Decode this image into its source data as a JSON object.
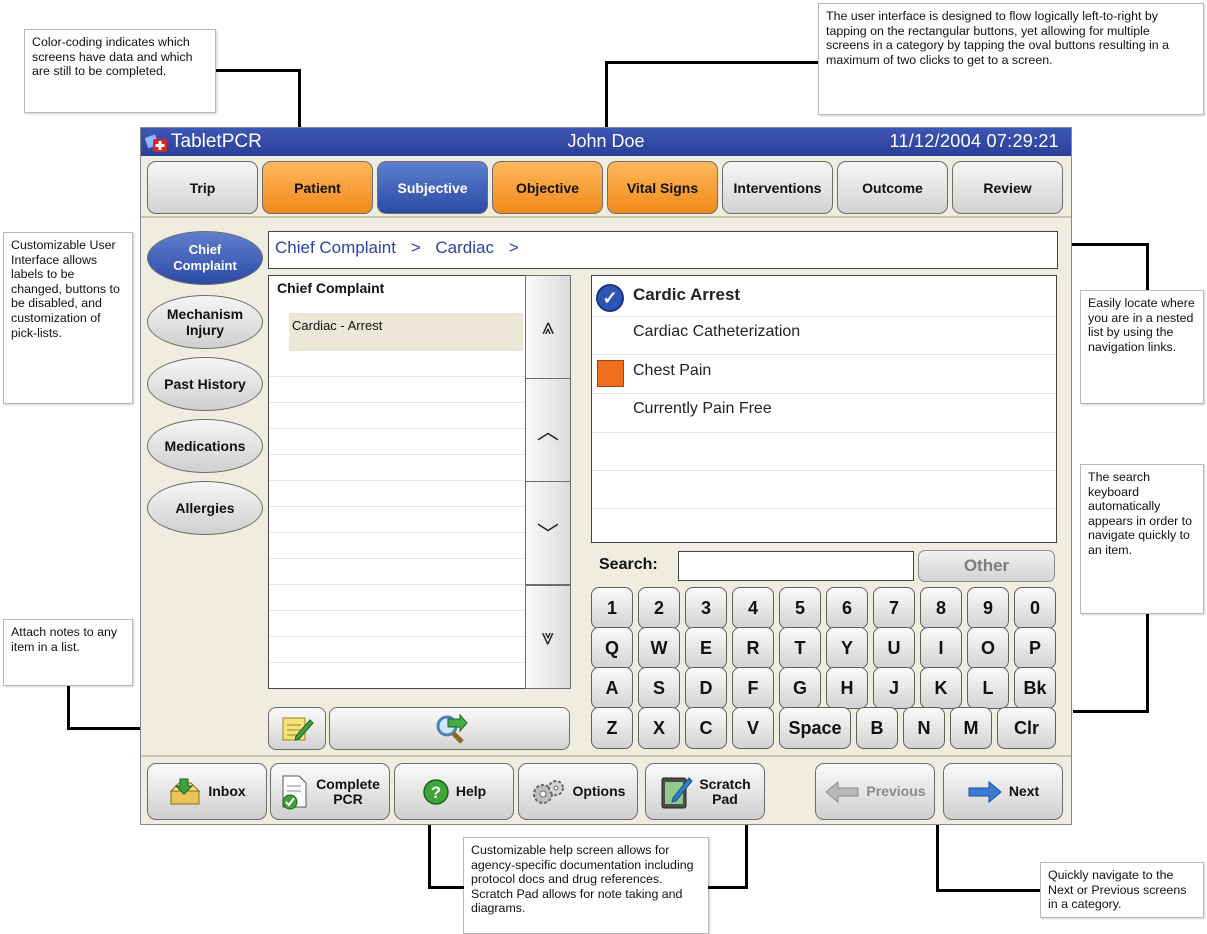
{
  "callouts": {
    "color_coding": "Color-coding indicates which screens have data and which are still to be completed.",
    "flow": "The user interface is designed to flow logically left-to-right by tapping on the rectangular buttons, yet allowing for multiple screens in a category by tapping the oval buttons resulting in a maximum of two clicks to get to a screen.",
    "customizable": "Customizable User Interface allows labels to be changed, buttons to be disabled, and customization of pick-lists.",
    "locate": "Easily locate where you are in a nested list by using the navigation links.",
    "search_kb": "The search keyboard automatically appears in order to navigate quickly to an item.",
    "attach": "Attach notes to any item in a list.",
    "help": "Customizable help screen allows for agency-specific documentation including protocol docs and drug references. Scratch Pad allows for note taking and diagrams.",
    "nav": "Quickly navigate to the Next or Previous screens in a category."
  },
  "titlebar": {
    "app_name": "TabletPCR",
    "patient_name": "John Doe",
    "datetime": "11/12/2004 07:29:21"
  },
  "tabs": [
    {
      "label": "Trip",
      "state": "default"
    },
    {
      "label": "Patient",
      "state": "orange"
    },
    {
      "label": "Subjective",
      "state": "blue"
    },
    {
      "label": "Objective",
      "state": "orange"
    },
    {
      "label": "Vital Signs",
      "state": "orange"
    },
    {
      "label": "Interventions",
      "state": "default"
    },
    {
      "label": "Outcome",
      "state": "default"
    },
    {
      "label": "Review",
      "state": "default"
    }
  ],
  "side_nav": [
    {
      "label_1": "Chief",
      "label_2": "Complaint",
      "active": true
    },
    {
      "label_1": "Mechanism",
      "label_2": "Injury",
      "active": false
    },
    {
      "label_1": "Past History",
      "label_2": "",
      "active": false
    },
    {
      "label_1": "Medications",
      "label_2": "",
      "active": false
    },
    {
      "label_1": "Allergies",
      "label_2": "",
      "active": false
    }
  ],
  "breadcrumb": {
    "item1": "Chief Complaint",
    "sep1": ">",
    "item2": "Cardiac",
    "sep2": ">"
  },
  "list": {
    "header": "Chief Complaint",
    "selected_item": "Cardiac - Arrest"
  },
  "scroll": {
    "top": "⩓",
    "up": "︿",
    "down": "﹀",
    "bottom": "⩔"
  },
  "pick_list": [
    {
      "label": "Cardic Arrest",
      "marker": "check",
      "bold": true
    },
    {
      "label": "Cardiac Catheterization",
      "marker": "none",
      "bold": false
    },
    {
      "label": "Chest Pain",
      "marker": "orange-square",
      "bold": false
    },
    {
      "label": "Currently Pain Free",
      "marker": "none",
      "bold": false
    }
  ],
  "check_glyph": "✓",
  "search": {
    "label": "Search:",
    "value": "",
    "other_label": "Other"
  },
  "keyboard": {
    "row1": [
      "1",
      "2",
      "3",
      "4",
      "5",
      "6",
      "7",
      "8",
      "9",
      "0"
    ],
    "row2": [
      "Q",
      "W",
      "E",
      "R",
      "T",
      "Y",
      "U",
      "I",
      "O",
      "P"
    ],
    "row3": [
      "A",
      "S",
      "D",
      "F",
      "G",
      "H",
      "J",
      "K",
      "L",
      "Bk"
    ],
    "row4": [
      "Z",
      "X",
      "C",
      "V",
      "Space",
      "B",
      "N",
      "M",
      "Clr"
    ]
  },
  "bottom_buttons": {
    "inbox": "Inbox",
    "complete_1": "Complete",
    "complete_2": "PCR",
    "help": "Help",
    "options": "Options",
    "scratch_1": "Scratch",
    "scratch_2": "Pad",
    "previous": "Previous",
    "next": "Next"
  },
  "colors": {
    "title_blue": "#2e45a0",
    "tab_orange": "#f28c1e",
    "tab_blue": "#3550ad",
    "breadcrumb_text": "#2a44a6",
    "marker_orange": "#ee6f1e",
    "panel_bg": "#efece0"
  }
}
